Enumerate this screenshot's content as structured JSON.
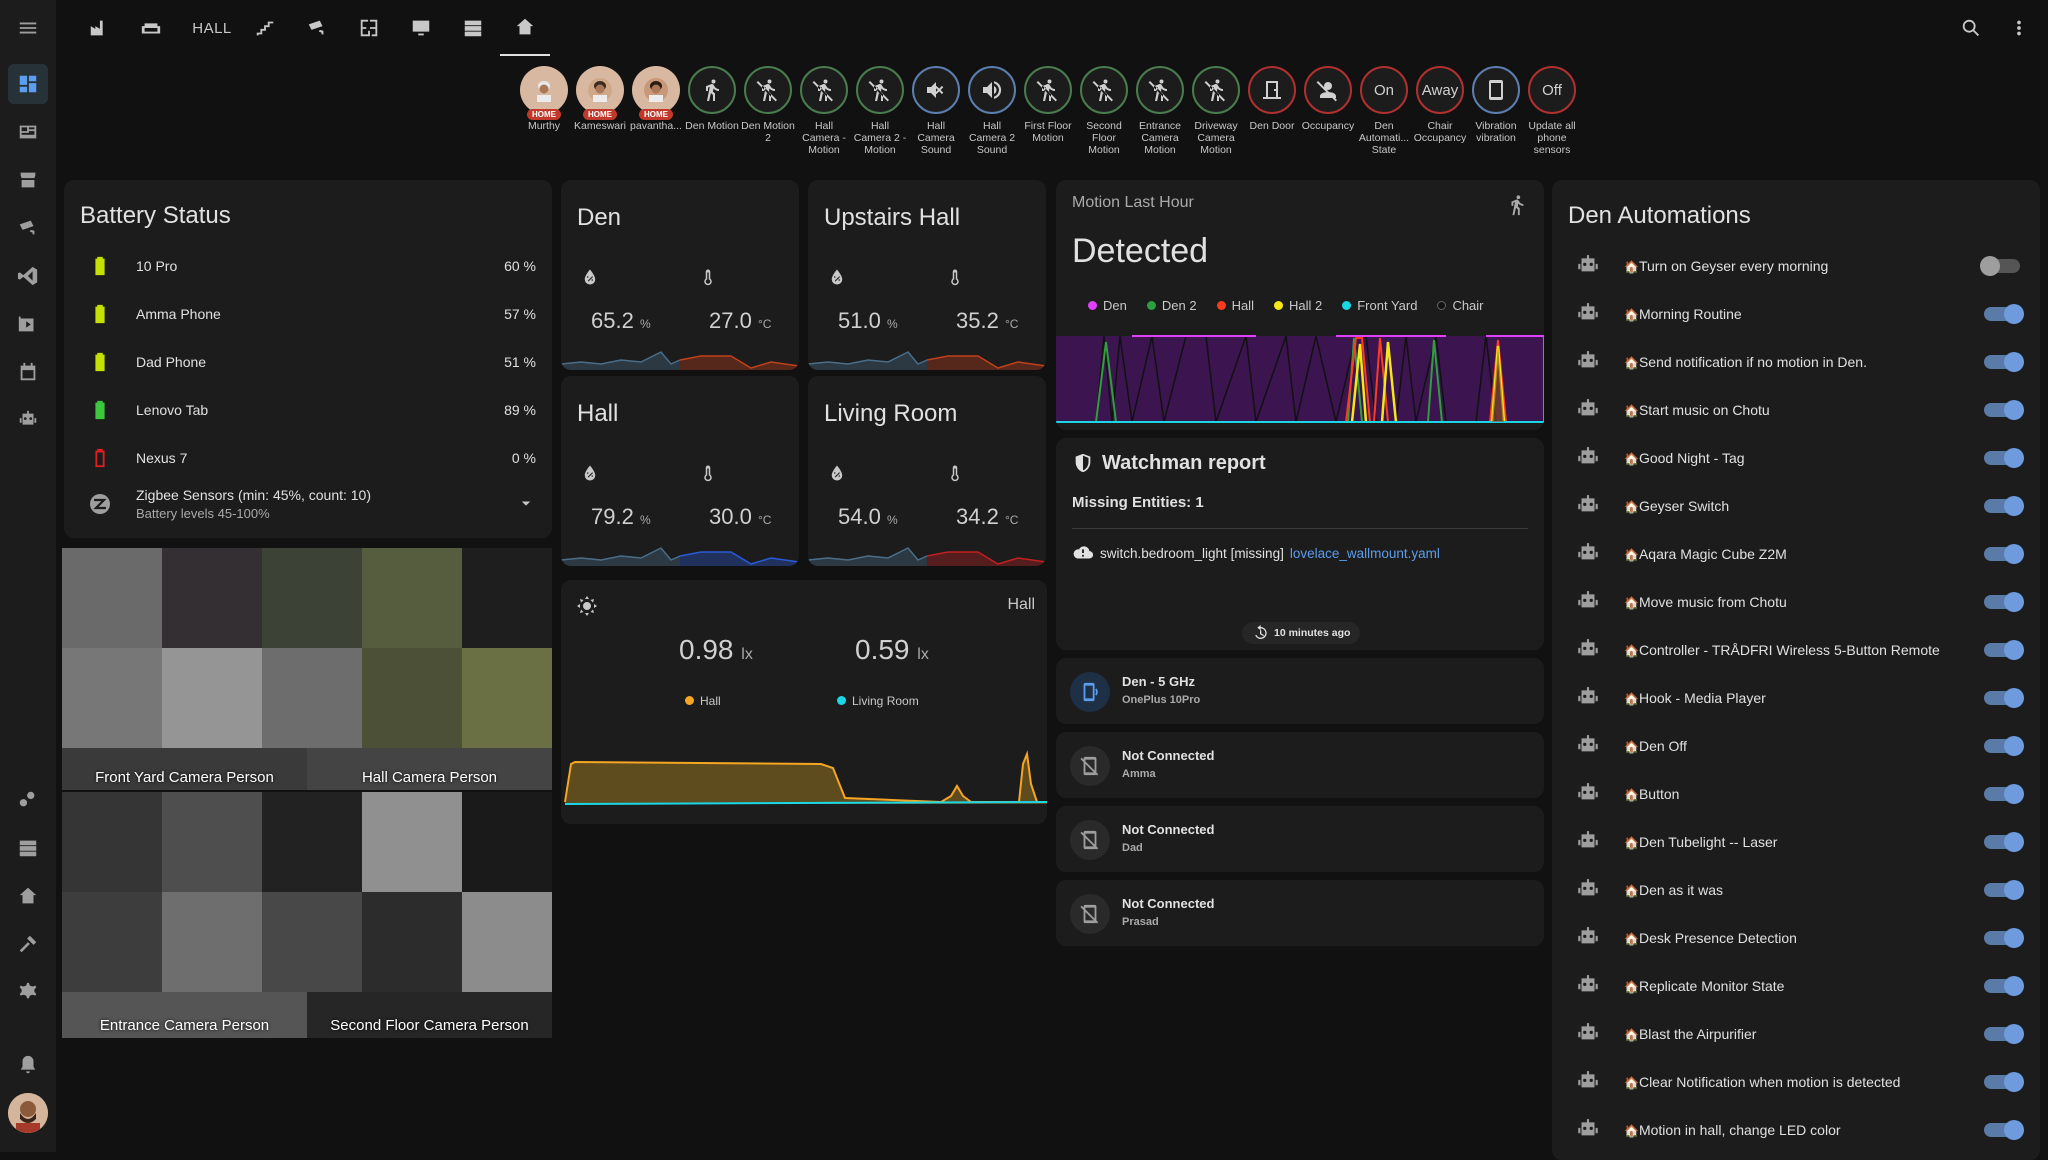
{
  "topbar": {
    "tab_text": "HALL"
  },
  "badges": [
    {
      "label": "Murthy",
      "state": "HOME"
    },
    {
      "label": "Kameswari",
      "state": "HOME"
    },
    {
      "label": "pavantha...",
      "state": "HOME"
    },
    {
      "label": "Den Motion",
      "icon": "motion-icon"
    },
    {
      "label": "Den Motion 2",
      "icon": "motion-off-icon"
    },
    {
      "label": "Hall Camera - Motion",
      "icon": "motion-off-icon"
    },
    {
      "label": "Hall Camera 2 - Motion",
      "icon": "motion-off-icon"
    },
    {
      "label": "Hall Camera Sound",
      "icon": "volume-off-icon"
    },
    {
      "label": "Hall Camera 2 Sound",
      "icon": "volume-icon"
    },
    {
      "label": "First Floor Motion",
      "icon": "motion-off-icon"
    },
    {
      "label": "Second Floor Motion",
      "icon": "motion-off-icon"
    },
    {
      "label": "Entrance Camera Motion",
      "icon": "motion-off-icon"
    },
    {
      "label": "Driveway Camera Motion",
      "icon": "motion-off-icon"
    },
    {
      "label": "Den Door",
      "icon": "door-icon"
    },
    {
      "label": "Occupancy",
      "icon": "person-off-icon"
    },
    {
      "label": "Den Automati... State",
      "value": "On"
    },
    {
      "label": "Chair Occupancy",
      "value": "Away"
    },
    {
      "label": "Vibration vibration",
      "icon": "phone-icon"
    },
    {
      "label": "Update all phone sensors",
      "value": "Off"
    }
  ],
  "battery": {
    "title": "Battery Status",
    "rows": [
      {
        "name": "10 Pro",
        "value": "60 %",
        "color": "#c6e000"
      },
      {
        "name": "Amma Phone",
        "value": "57 %",
        "color": "#c6e000"
      },
      {
        "name": "Dad Phone",
        "value": "51 %",
        "color": "#c6e000"
      },
      {
        "name": "Lenovo Tab",
        "value": "89 %",
        "color": "#3cc83c"
      },
      {
        "name": "Nexus 7",
        "value": "0 %",
        "color": "#e02020"
      }
    ],
    "zigbee": {
      "name": "Zigbee Sensors (min: 45%, count: 10)",
      "sub": "Battery levels 45-100%"
    }
  },
  "rooms": [
    {
      "name": "Den",
      "humidity": "65.2",
      "temp": "27.0"
    },
    {
      "name": "Upstairs Hall",
      "humidity": "51.0",
      "temp": "35.2"
    },
    {
      "name": "Hall",
      "humidity": "79.2",
      "temp": "30.0"
    },
    {
      "name": "Living Room",
      "humidity": "54.0",
      "temp": "34.2"
    }
  ],
  "units": {
    "humidity": "%",
    "temp": "°C",
    "lux": "lx"
  },
  "light": {
    "name": "Hall",
    "hall_value": "0.98",
    "living_value": "0.59",
    "legend": [
      "Hall",
      "Living Room"
    ]
  },
  "motion": {
    "title": "Motion Last Hour",
    "state": "Detected",
    "legend": [
      {
        "name": "Den",
        "color": "#e040fb"
      },
      {
        "name": "Den 2",
        "color": "#2e9e3e"
      },
      {
        "name": "Hall",
        "color": "#ff3b1f"
      },
      {
        "name": "Hall 2",
        "color": "#f5e61a"
      },
      {
        "name": "Front Yard",
        "color": "#1ad7e6"
      },
      {
        "name": "Chair",
        "color": "#111111"
      }
    ]
  },
  "watchman": {
    "title": "Watchman report",
    "missing": "Missing Entities: 1",
    "entity": "switch.bedroom_light [missing]",
    "file": "lovelace_wallmount.yaml",
    "ago": "10 minutes ago"
  },
  "connections": [
    {
      "name": "Den - 5 GHz",
      "sub": "OnePlus 10Pro",
      "connected": true
    },
    {
      "name": "Not Connected",
      "sub": "Amma",
      "connected": false
    },
    {
      "name": "Not Connected",
      "sub": "Dad",
      "connected": false
    },
    {
      "name": "Not Connected",
      "sub": "Prasad",
      "connected": false
    }
  ],
  "cameras": [
    {
      "label": "Front Yard Camera Person"
    },
    {
      "label": "Hall Camera Person"
    },
    {
      "label": "Entrance Camera Person"
    },
    {
      "label": "Second Floor Camera Person"
    }
  ],
  "automations": {
    "title": "Den Automations",
    "items": [
      {
        "name": "Turn on Geyser every morning",
        "on": false
      },
      {
        "name": "Morning Routine",
        "on": true
      },
      {
        "name": "Send notification if no motion in Den.",
        "on": true
      },
      {
        "name": "Start music on Chotu",
        "on": true
      },
      {
        "name": "Good Night - Tag",
        "on": true
      },
      {
        "name": "Geyser Switch",
        "on": true
      },
      {
        "name": "Aqara Magic Cube Z2M",
        "on": true
      },
      {
        "name": "Move music from Chotu",
        "on": true
      },
      {
        "name": "Controller - TRÅDFRI Wireless 5-Button Remote",
        "on": true
      },
      {
        "name": "Hook - Media Player",
        "on": true
      },
      {
        "name": "Den Off",
        "on": true
      },
      {
        "name": "Button",
        "on": true
      },
      {
        "name": "Den Tubelight -- Laser",
        "on": true
      },
      {
        "name": "Den as it was",
        "on": true
      },
      {
        "name": "Desk Presence Detection",
        "on": true
      },
      {
        "name": "Replicate Monitor State",
        "on": true
      },
      {
        "name": "Blast the Airpurifier",
        "on": true
      },
      {
        "name": "Clear Notification when motion is detected",
        "on": true
      },
      {
        "name": "Motion in hall, change LED color",
        "on": true
      }
    ]
  }
}
